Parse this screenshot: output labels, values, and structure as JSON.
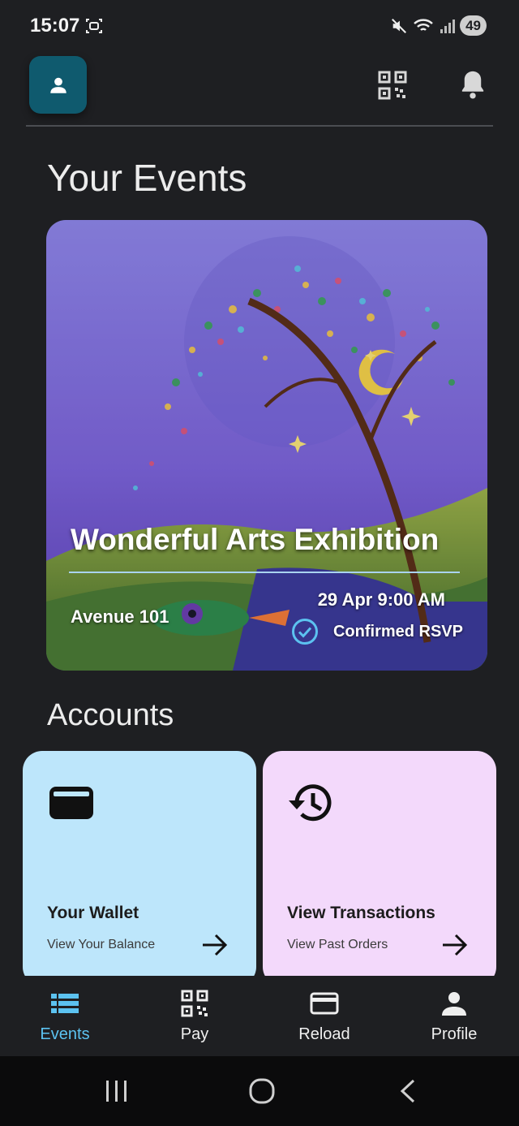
{
  "status": {
    "time": "15:07",
    "battery": "49"
  },
  "header": {
    "profile_icon": "person-icon",
    "qr_icon": "qr-code-icon",
    "bell_icon": "bell-icon"
  },
  "events": {
    "title": "Your Events",
    "items": [
      {
        "name": "Wonderful Arts Exhibition",
        "venue": "Avenue 101",
        "datetime": "29 Apr 9:00 AM",
        "status": "Confirmed RSVP"
      }
    ]
  },
  "accounts": {
    "title": "Accounts",
    "cards": [
      {
        "title": "Your Wallet",
        "subtitle": "View Your Balance",
        "icon": "wallet-icon"
      },
      {
        "title": "View Transactions",
        "subtitle": "View Past Orders",
        "icon": "history-icon"
      }
    ]
  },
  "nav": {
    "items": [
      {
        "label": "Events",
        "icon": "list-icon",
        "active": true
      },
      {
        "label": "Pay",
        "icon": "qr-code-icon",
        "active": false
      },
      {
        "label": "Reload",
        "icon": "card-icon",
        "active": false
      },
      {
        "label": "Profile",
        "icon": "person-icon",
        "active": false
      }
    ]
  },
  "colors": {
    "accent": "#5cc2f0",
    "wallet_card": "#bde6fb",
    "transactions_card": "#f3d9fb",
    "avatar_bg": "#0f5a6e",
    "background": "#1e1f22"
  }
}
